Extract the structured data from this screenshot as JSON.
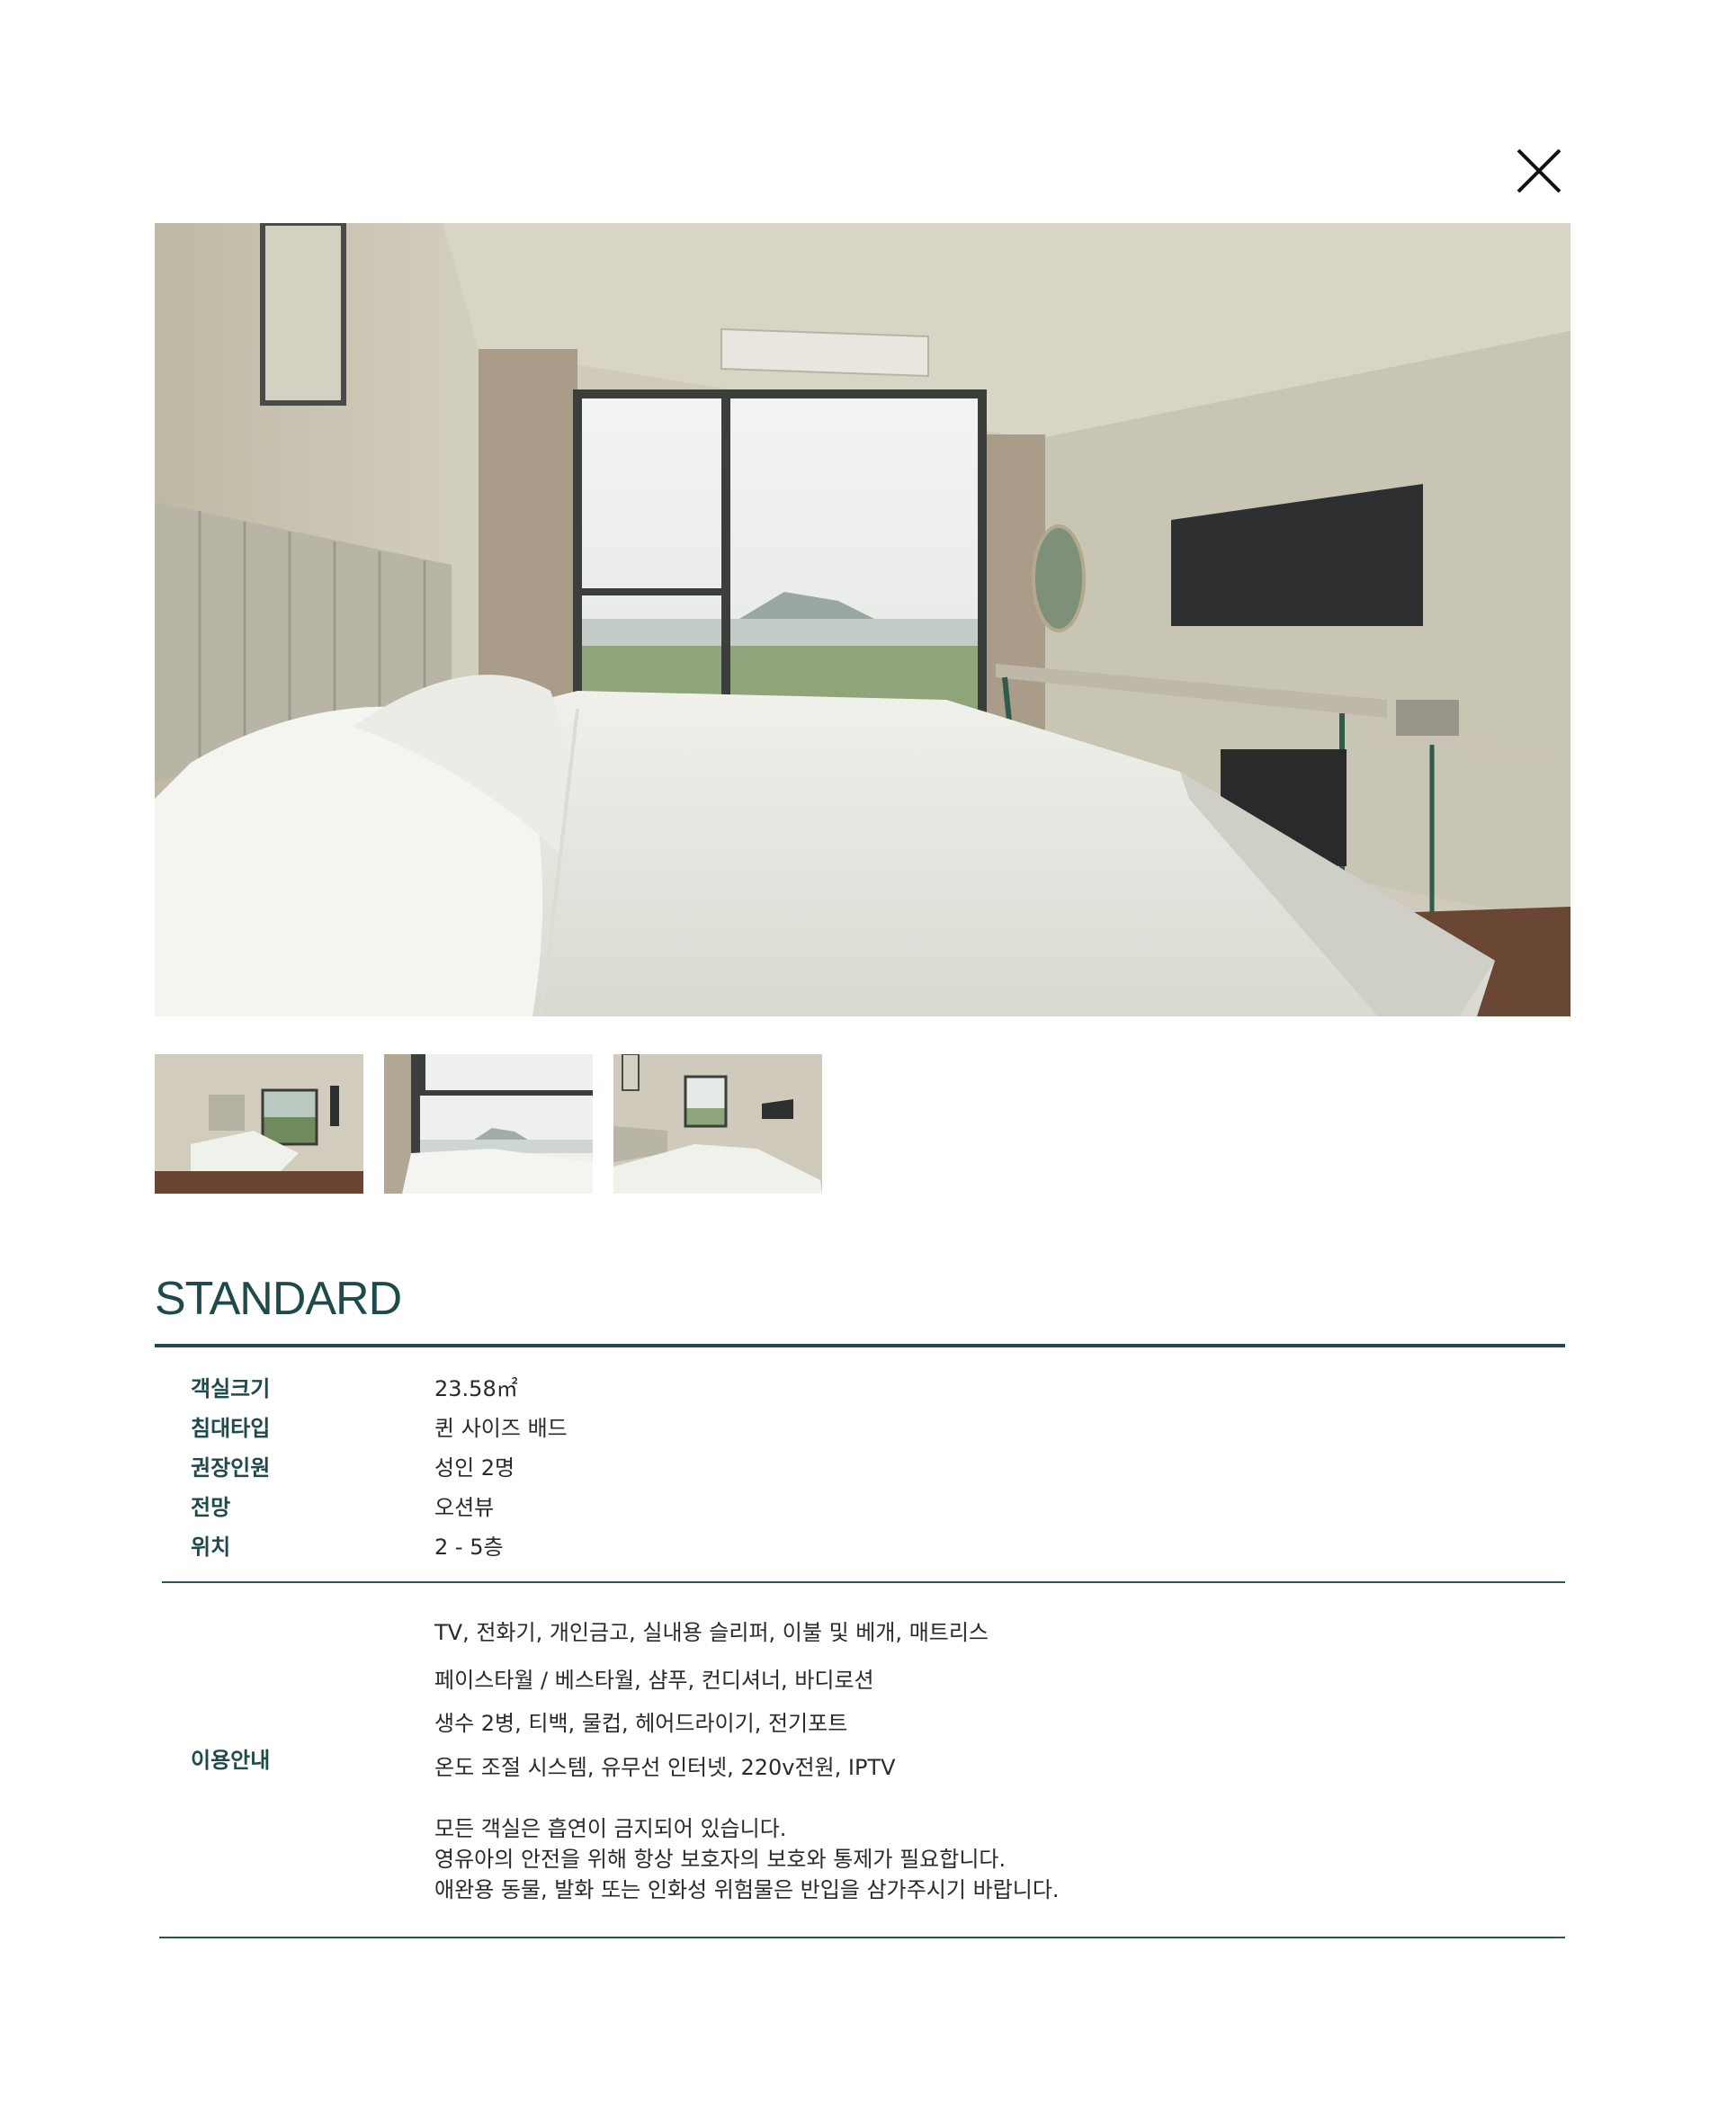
{
  "icons": {
    "close": "close-icon"
  },
  "colors": {
    "accent": "#1f4a4b",
    "text": "#2a2a2a",
    "background": "#ffffff"
  },
  "room": {
    "title": "STANDARD"
  },
  "gallery": {
    "main_alt": "객실 메인 사진",
    "thumbnails": [
      "객실 사진 1",
      "객실 사진 2",
      "객실 사진 3"
    ]
  },
  "specs": [
    {
      "label": "객실크기",
      "value": "23.58㎡"
    },
    {
      "label": "침대타입",
      "value": "퀸 사이즈 배드"
    },
    {
      "label": "권장인원",
      "value": "성인 2명"
    },
    {
      "label": "전망",
      "value": "오션뷰"
    },
    {
      "label": "위치",
      "value": "2 - 5층"
    }
  ],
  "usage": {
    "label": "이용안내",
    "amenities": [
      "TV, 전화기, 개인금고, 실내용 슬리퍼, 이불 및 베개, 매트리스",
      "페이스타월 / 베스타월, 샴푸, 컨디셔너, 바디로션",
      "생수 2병, 티백, 물컵, 헤어드라이기, 전기포트",
      "온도 조절 시스템, 유무선 인터넷, 220v전원, IPTV"
    ],
    "notices": [
      "모든 객실은 흡연이 금지되어 있습니다.",
      "영유아의 안전을 위해 항상 보호자의 보호와 통제가 필요합니다.",
      "애완용 동물, 발화 또는 인화성 위험물은 반입을 삼가주시기 바랍니다."
    ]
  }
}
